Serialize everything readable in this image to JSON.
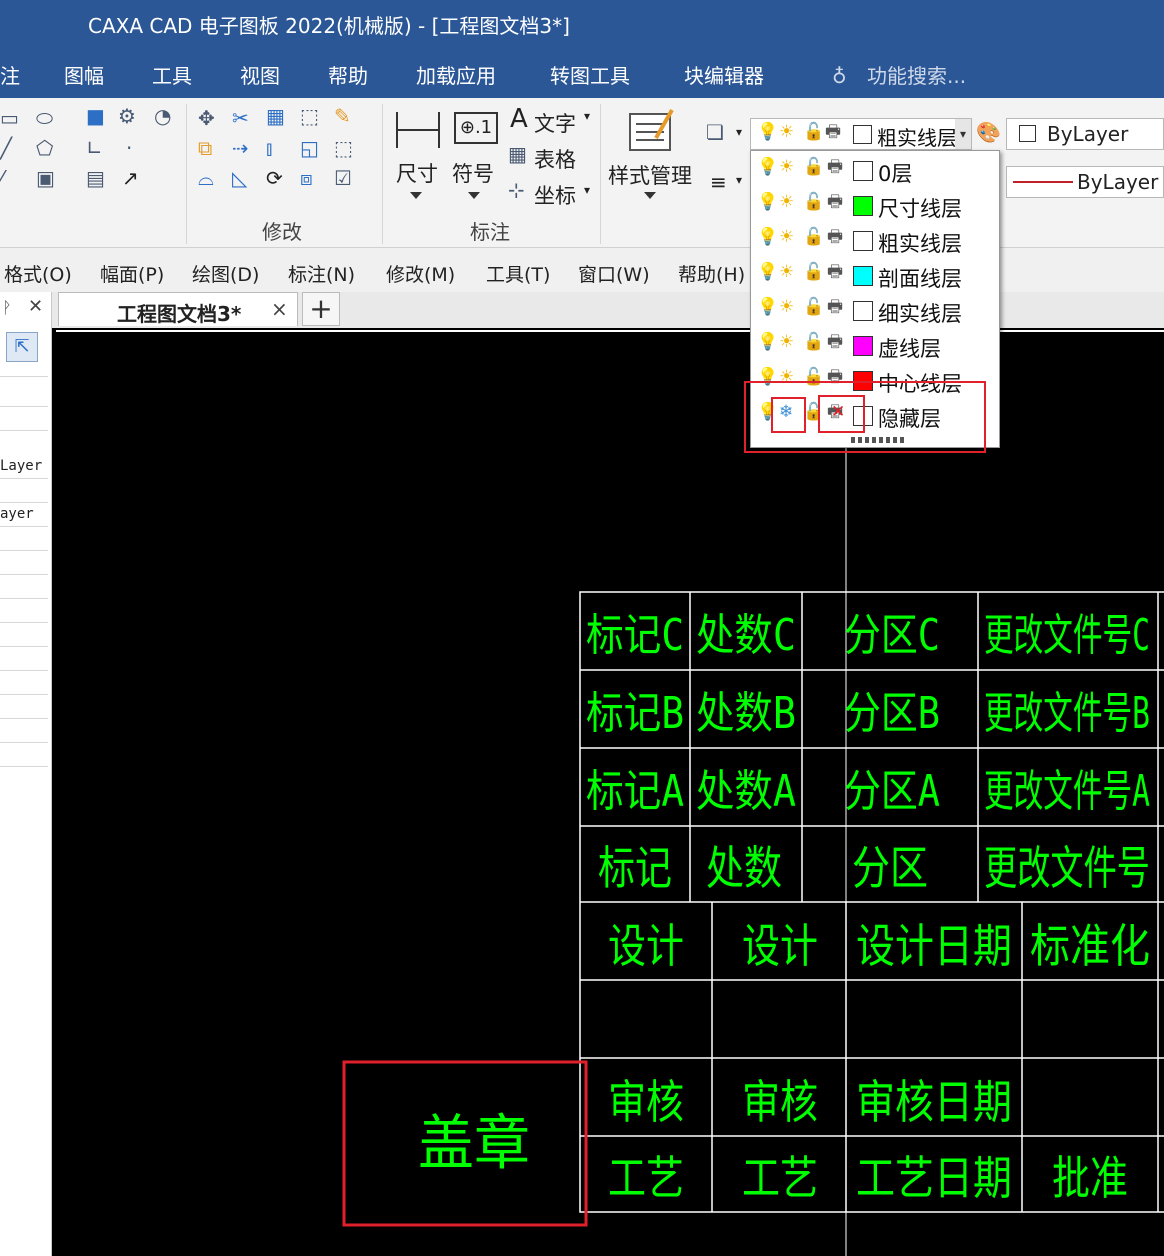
{
  "window": {
    "title": "CAXA CAD 电子图板 2022(机械版) - [工程图文档3*]"
  },
  "ribbon_tabs": [
    "注",
    "图幅",
    "工具",
    "视图",
    "帮助",
    "加载应用",
    "转图工具",
    "块编辑器"
  ],
  "search": {
    "placeholder": "功能搜索..."
  },
  "ribbon": {
    "groups": {
      "modify": "修改",
      "annotate": "标注"
    },
    "buttons": {
      "dimension": "尺寸",
      "symbol": "符号",
      "text": "文字",
      "table": "表格",
      "coordinate": "坐标",
      "style_manager": "样式管理"
    },
    "current_layer": "粗实线层",
    "color_combo": "ByLayer",
    "linetype_combo": "ByLayer"
  },
  "menubar": [
    "格式(O)",
    "幅面(P)",
    "绘图(D)",
    "标注(N)",
    "修改(M)",
    "工具(T)",
    "窗口(W)",
    "帮助(H)"
  ],
  "doc_tab": {
    "label": "工程图文档3*",
    "close": "×",
    "add": "+"
  },
  "left_pane": {
    "rows": [
      "Layer",
      "ayer"
    ]
  },
  "layers": [
    {
      "name": "0层",
      "color": "#ffffff",
      "frozen": false,
      "no_print": false
    },
    {
      "name": "尺寸线层",
      "color": "#00ff00",
      "frozen": false,
      "no_print": false
    },
    {
      "name": "粗实线层",
      "color": "#ffffff",
      "frozen": false,
      "no_print": false
    },
    {
      "name": "剖面线层",
      "color": "#00ffff",
      "frozen": false,
      "no_print": false
    },
    {
      "name": "细实线层",
      "color": "#ffffff",
      "frozen": false,
      "no_print": false
    },
    {
      "name": "虚线层",
      "color": "#ff00ff",
      "frozen": false,
      "no_print": false
    },
    {
      "name": "中心线层",
      "color": "#ff0000",
      "frozen": false,
      "no_print": false
    },
    {
      "name": "隐藏层",
      "color": "#ffffff",
      "frozen": true,
      "no_print": true
    }
  ],
  "title_block": {
    "rows_upper": [
      [
        "标记C",
        "处数C",
        "分区C",
        "更改文件号C"
      ],
      [
        "标记B",
        "处数B",
        "分区B",
        "更改文件号B"
      ],
      [
        "标记A",
        "处数A",
        "分区A",
        "更改文件号A"
      ],
      [
        "标记",
        "处数",
        "分区",
        "更改文件号"
      ]
    ],
    "rows_lower": [
      [
        "设计",
        "设计",
        "设计日期",
        "标准化"
      ],
      [
        "",
        "",
        "",
        ""
      ],
      [
        "审核",
        "审核",
        "审核日期",
        ""
      ],
      [
        "工艺",
        "工艺",
        "工艺日期",
        "批准"
      ]
    ],
    "stamp": "盖章"
  },
  "colors": {
    "drawing_text": "#00ff00",
    "highlight": "#e0202a",
    "title_bar": "#2b5797"
  }
}
